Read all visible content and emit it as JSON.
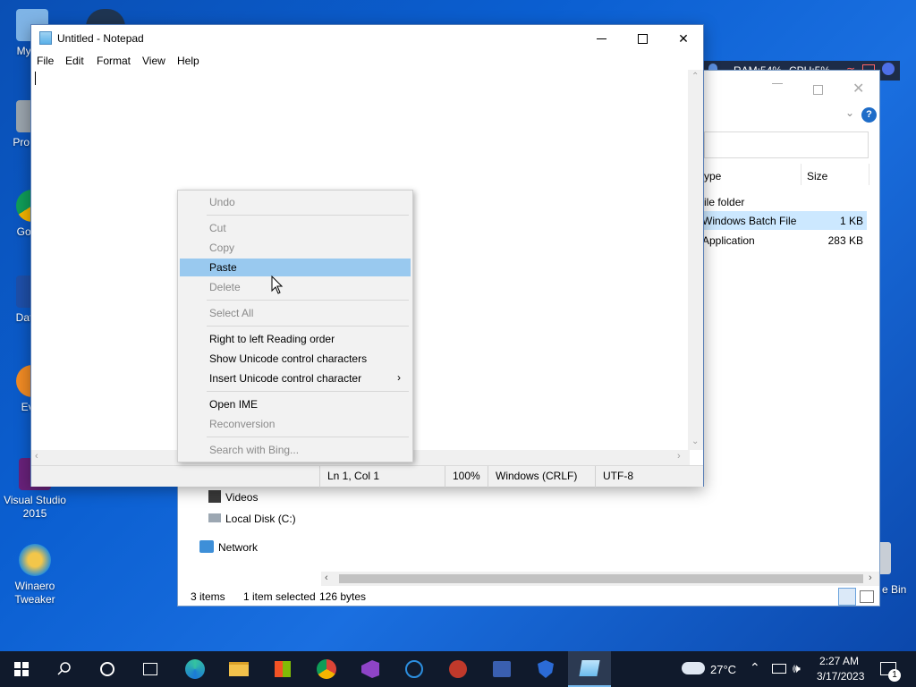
{
  "desktop": {
    "icons": [
      {
        "label": "My Co"
      },
      {
        "label": "Pro Hac"
      },
      {
        "label": "Go Ch"
      },
      {
        "label": "DataW"
      },
      {
        "label": "Ever"
      },
      {
        "label": "Visual Studio 2015"
      },
      {
        "label": "Winaero Tweaker"
      }
    ],
    "recycle_label": "e Bin"
  },
  "overlay": {
    "ram": "RAM:54%",
    "cpu": "CPU:5%"
  },
  "explorer": {
    "headers": {
      "type": "ype",
      "size": "Size"
    },
    "rows": [
      {
        "type": "ile folder",
        "size": ""
      },
      {
        "type": "Windows Batch File",
        "size": "1 KB"
      },
      {
        "type": "Application",
        "size": "283 KB"
      }
    ],
    "nav": {
      "videos": "Videos",
      "local_disk": "Local Disk (C:)",
      "network": "Network"
    },
    "status": {
      "items": "3 items",
      "selected": "1 item selected",
      "bytes": "126 bytes"
    }
  },
  "notepad": {
    "title": "Untitled - Notepad",
    "menu": {
      "file": "File",
      "edit": "Edit",
      "format": "Format",
      "view": "View",
      "help": "Help"
    },
    "status": {
      "position": "Ln 1, Col 1",
      "zoom": "100%",
      "line_ending": "Windows (CRLF)",
      "encoding": "UTF-8"
    }
  },
  "context_menu": {
    "undo": "Undo",
    "cut": "Cut",
    "copy": "Copy",
    "paste": "Paste",
    "delete": "Delete",
    "select_all": "Select All",
    "rtl": "Right to left Reading order",
    "show_unicode": "Show Unicode control characters",
    "insert_unicode": "Insert Unicode control character",
    "open_ime": "Open IME",
    "reconversion": "Reconversion",
    "search_bing": "Search with Bing..."
  },
  "taskbar": {
    "weather_temp": "27°C",
    "time": "2:27 AM",
    "date": "3/17/2023",
    "notification_count": "1"
  },
  "colors": {
    "highlight": "#99c9ef",
    "taskbar": "#101a2c",
    "desktop": "#0b5fd1"
  }
}
